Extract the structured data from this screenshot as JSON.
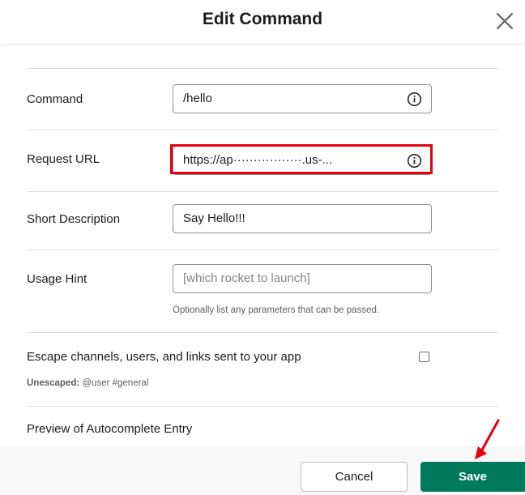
{
  "dialog": {
    "title": "Edit Command"
  },
  "form": {
    "command": {
      "label": "Command",
      "value": "/hello"
    },
    "request_url": {
      "label": "Request URL",
      "value": "https://ap·················.us-..."
    },
    "short_description": {
      "label": "Short Description",
      "value": "Say Hello!!!"
    },
    "usage_hint": {
      "label": "Usage Hint",
      "placeholder": "[which rocket to launch]",
      "help_text": "Optionally list any parameters that can be passed."
    },
    "escape": {
      "label": "Escape channels, users, and links sent to your app",
      "checked": false,
      "note_bold": "Unescaped:",
      "note_text": " @user #general"
    },
    "preview": {
      "label": "Preview of Autocomplete Entry"
    }
  },
  "footer": {
    "cancel_label": "Cancel",
    "save_label": "Save"
  },
  "icons": {
    "close": "close-icon",
    "info": "info-icon"
  },
  "colors": {
    "primary": "#007a5a",
    "highlight": "#e3000f",
    "annotation_arrow": "#e3000f"
  }
}
